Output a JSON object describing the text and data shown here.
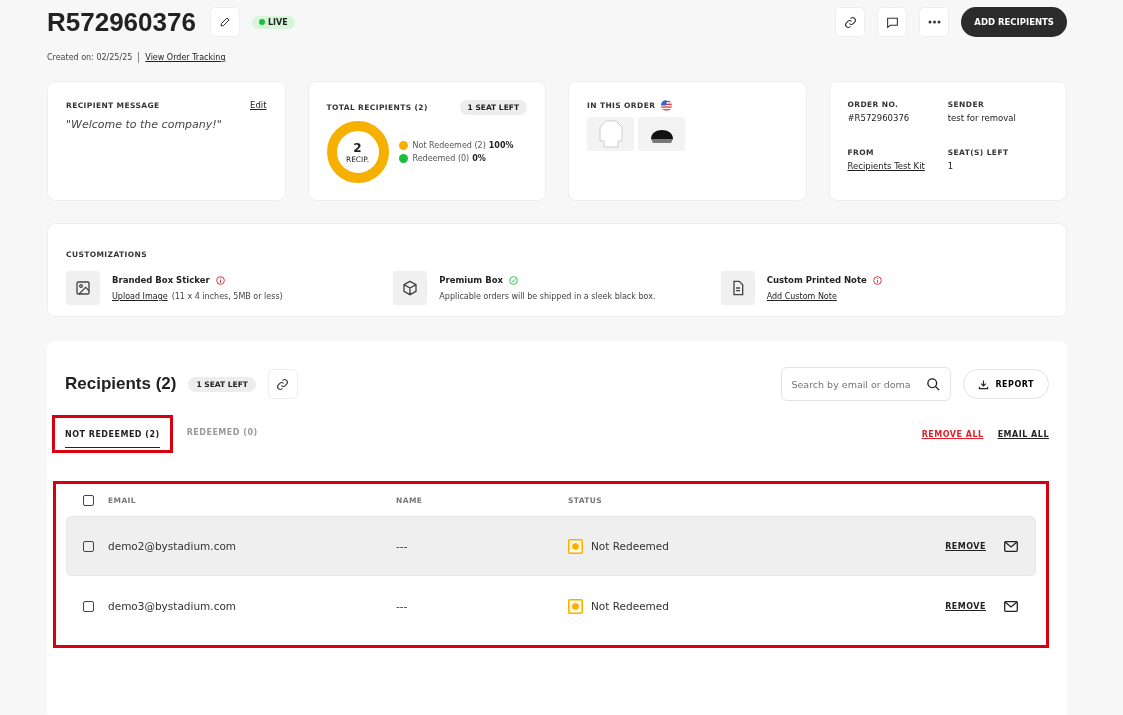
{
  "header": {
    "order_id": "R572960376",
    "status": "LIVE",
    "created": "Created on: 02/25/25",
    "tracking_link": "View Order Tracking",
    "add_button": "ADD RECIPIENTS"
  },
  "message_card": {
    "title": "RECIPIENT MESSAGE",
    "edit": "Edit",
    "message": "\"Welcome to the company!\""
  },
  "recipients_card": {
    "title": "TOTAL RECIPIENTS (2)",
    "badge": "1 SEAT LEFT",
    "total": "2",
    "total_label": "RECIP.",
    "legend": [
      {
        "label": "Not Redeemed (2)",
        "percent": "100%",
        "color": "#f5b000"
      },
      {
        "label": "Redeemed (0)",
        "percent": "0%",
        "color": "#1cbf3c"
      }
    ]
  },
  "order_card": {
    "title": "IN THIS ORDER",
    "products": [
      {
        "kind": "hoodie"
      },
      {
        "kind": "cap"
      }
    ]
  },
  "info_card": {
    "fields": [
      {
        "label": "ORDER NO.",
        "value": "#R572960376",
        "kind": "text"
      },
      {
        "label": "SENDER",
        "value": "test for removal",
        "kind": "text"
      },
      {
        "label": "FROM",
        "value": "Recipients Test Kit",
        "kind": "link"
      },
      {
        "label": "SEAT(S) LEFT",
        "value": "1",
        "kind": "text"
      }
    ]
  },
  "customizations": {
    "title": "CUSTOMIZATIONS",
    "items": [
      {
        "kind": "image",
        "name": "Branded Box Sticker",
        "complete": false,
        "link": "Upload Image",
        "note": "(11 x 4 inches, 5MB or less)"
      },
      {
        "kind": "box",
        "name": "Premium Box",
        "complete": true,
        "note": "Applicable orders will be shipped in a sleek black box."
      },
      {
        "kind": "document",
        "name": "Custom Printed Note",
        "complete": false,
        "link": "Add Custom Note"
      }
    ]
  },
  "recipients": {
    "title": "Recipients (2)",
    "badge": "1 SEAT LEFT",
    "search": {
      "placeholder": "Search by email or doma"
    },
    "report": "REPORT",
    "tabs": [
      {
        "label": "NOT REDEEMED (2)",
        "selected": true
      },
      {
        "label": "REDEEMED (0)",
        "selected": false
      }
    ],
    "remove_all": "REMOVE ALL",
    "email_all": "EMAIL ALL",
    "table": {
      "columns": [
        "EMAIL",
        "NAME",
        "STATUS"
      ],
      "select_all_checked": false,
      "rows": [
        {
          "email": "demo2@bystadium.com",
          "name": "---",
          "status": "Not Redeemed",
          "checked": false,
          "highlighted": true,
          "remove": "REMOVE"
        },
        {
          "email": "demo3@bystadium.com",
          "name": "---",
          "status": "Not Redeemed",
          "checked": false,
          "highlighted": false,
          "remove": "REMOVE"
        }
      ]
    }
  }
}
